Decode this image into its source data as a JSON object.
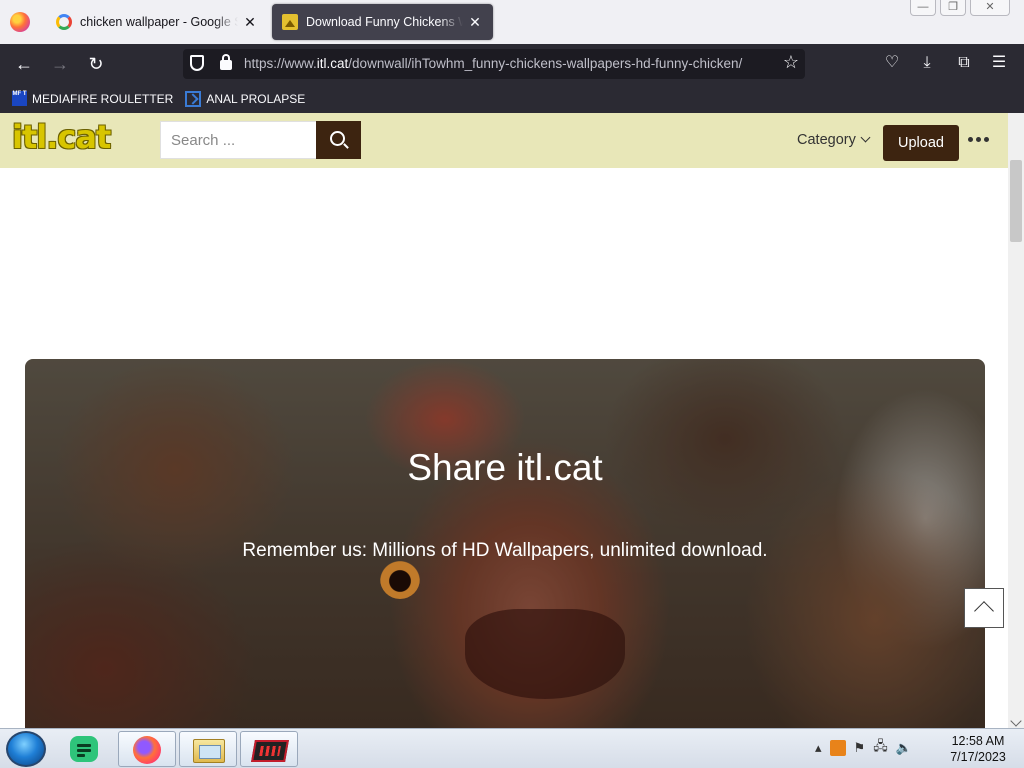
{
  "browser": {
    "tabs": [
      {
        "title": "chicken wallpaper - Google Search",
        "favicon": "google-icon",
        "active": false
      },
      {
        "title": "Download Funny Chickens Wallpapers",
        "favicon": "wallpaper-icon",
        "active": true
      }
    ],
    "url_prefix": "https://www.",
    "url_host": "itl.cat",
    "url_path": "/downwall/ihTowhm_funny-chickens-wallpapers-hd-funny-chicken/",
    "bookmarks": [
      {
        "label": "MEDIAFIRE ROULETTER",
        "icon": "mediafire-icon",
        "icon_text": "MF T"
      },
      {
        "label": "ANAL PROLAPSE",
        "icon": "bookmark-site-icon"
      }
    ]
  },
  "site": {
    "logo": "itl.cat",
    "search_placeholder": "Search ...",
    "category_label": "Category",
    "upload_label": "Upload",
    "hero_title": "Share itl.cat",
    "hero_subtitle": "Remember us: Millions of HD Wallpapers, unlimited download.",
    "colors": {
      "header_bg": "#e8e7b8",
      "brand_dark": "#3d2410",
      "logo_yellow": "#d8c500"
    }
  },
  "taskbar": {
    "apps": [
      "notes-app-icon",
      "firefox-icon",
      "file-explorer-icon",
      "media-app-icon"
    ],
    "clock_time": "12:58 AM",
    "clock_date": "7/17/2023"
  }
}
